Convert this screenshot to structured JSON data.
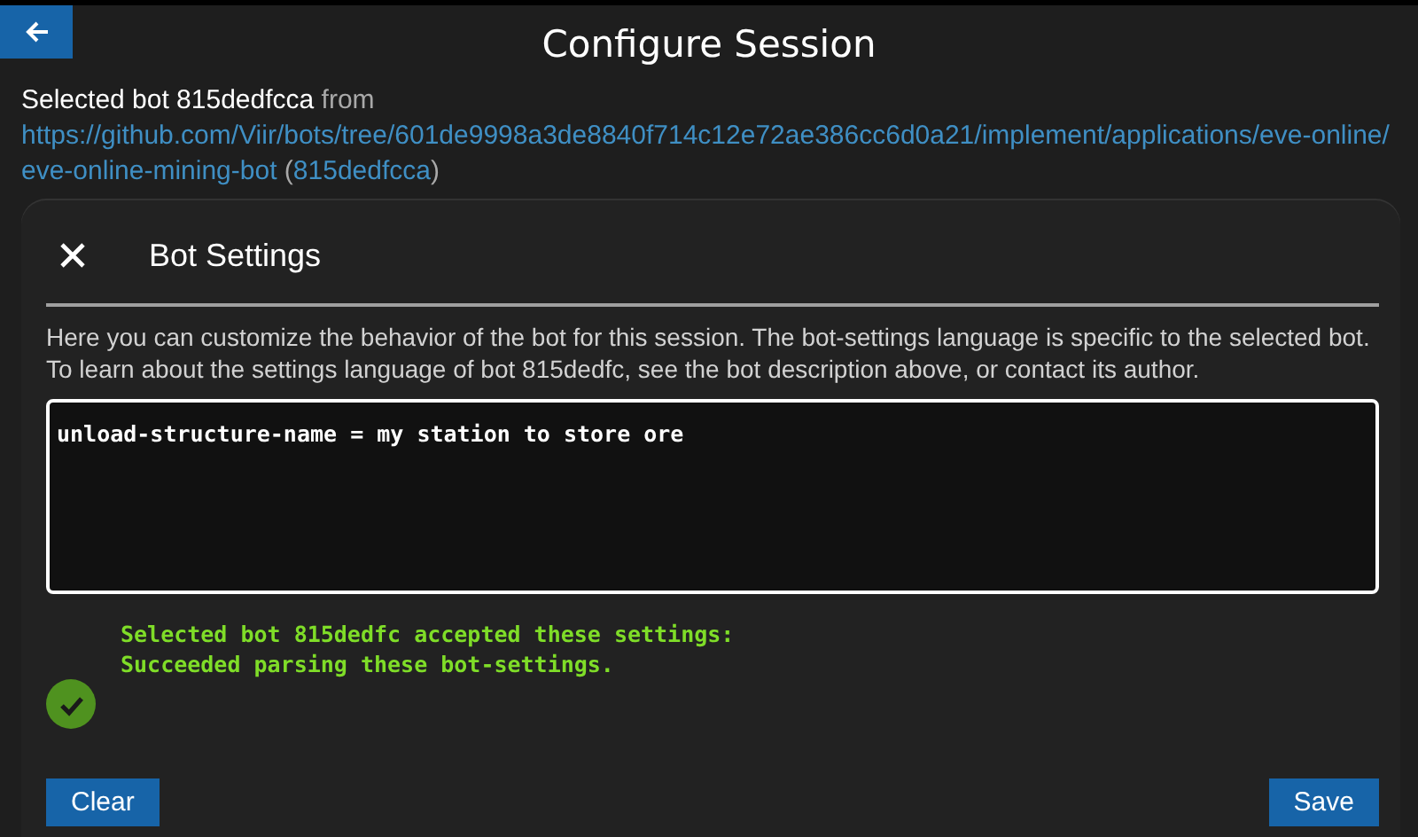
{
  "header": {
    "title": "Configure Session"
  },
  "selection": {
    "prefix": "Selected bot 815dedfcca",
    "joiner": "from",
    "link": "https://github.com/Viir/bots/tree/601de9998a3de8840f714c12e72ae386cc6d0a21/implement/applications/eve-online/eve-online-mining-bot",
    "open_paren": "(",
    "short_link": "815dedfcca",
    "close_paren": ")"
  },
  "dialog": {
    "title": "Bot Settings",
    "description": "Here you can customize the behavior of the bot for this session. The bot-settings language is specific to the selected bot. To learn about the settings language of bot 815dedfc, see the bot description above, or contact its author.",
    "settings_value": "unload-structure-name = my station to store ore",
    "status": {
      "kind": "success",
      "lines": [
        "Selected bot 815dedfc accepted these settings:",
        "Succeeded parsing these bot-settings."
      ]
    },
    "buttons": [
      {
        "label": "Clear",
        "kind": "clear"
      },
      {
        "label": "Save",
        "kind": "save"
      }
    ]
  }
}
